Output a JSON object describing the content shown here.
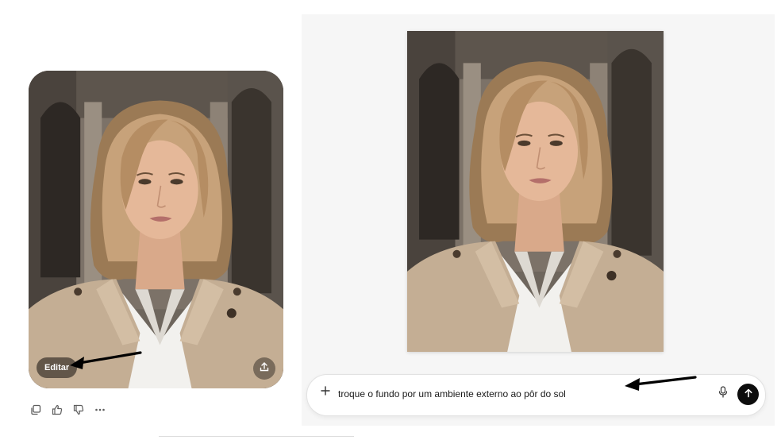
{
  "chat_image": {
    "edit_label": "Editar",
    "icons": {
      "share": "share-icon"
    }
  },
  "message_actions": [
    {
      "name": "copy",
      "icon": "copy-icon"
    },
    {
      "name": "like",
      "icon": "thumbs-up-icon"
    },
    {
      "name": "dislike",
      "icon": "thumbs-down-icon"
    },
    {
      "name": "more",
      "icon": "more-icon"
    }
  ],
  "editor": {
    "prompt": {
      "value": "troque o fundo por um ambiente externo ao pôr do sol",
      "icons": {
        "add": "plus-icon",
        "mic": "microphone-icon",
        "send": "arrow-up-icon"
      }
    }
  },
  "colors": {
    "send_button": "#0d0d0d",
    "panel_bg": "#f6f6f6",
    "arrow": "#000000"
  }
}
